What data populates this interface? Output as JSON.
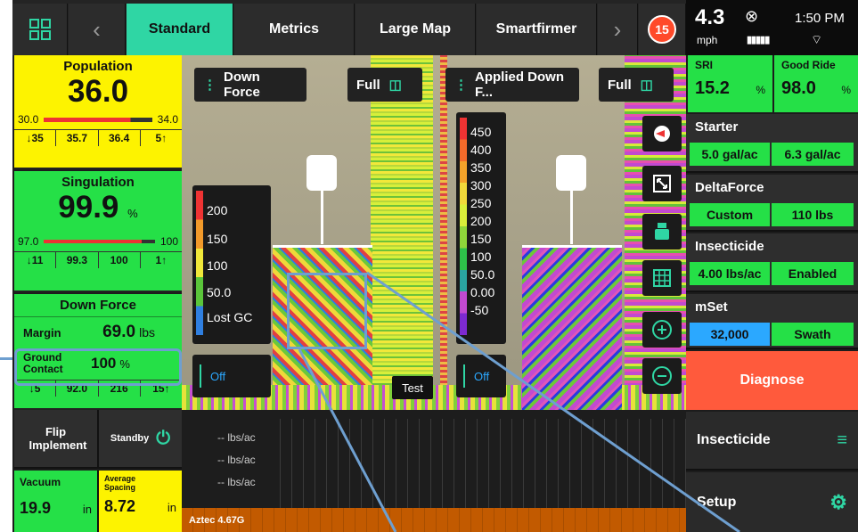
{
  "nav": {
    "tabs": [
      "Standard",
      "Metrics",
      "Large Map",
      "Smartfirmer"
    ],
    "alerts": "15"
  },
  "status": {
    "speed": "4.3",
    "speed_unit": "mph",
    "time": "1:50 PM"
  },
  "left": {
    "population": {
      "title": "Population",
      "value": "36.0",
      "min": "30.0",
      "max": "34.0",
      "row": [
        "35",
        "35.7",
        "36.4",
        "5"
      ]
    },
    "singulation": {
      "title": "Singulation",
      "value": "99.9",
      "unit": "%",
      "min": "97.0",
      "max": "100",
      "row": [
        "11",
        "99.3",
        "100",
        "1"
      ]
    },
    "downforce": {
      "title": "Down Force",
      "margin_label": "Margin",
      "margin_value": "69.0",
      "margin_unit": "lbs",
      "gc_label": "Ground Contact",
      "gc_value": "100",
      "gc_unit": "%",
      "row": [
        "5",
        "92.0",
        "216",
        "15"
      ]
    }
  },
  "map": {
    "left_header": "Down Force",
    "left_full": "Full",
    "right_header": "Applied Down F...",
    "right_full": "Full",
    "legend_left": [
      "200",
      "150",
      "100",
      "50.0",
      "Lost GC"
    ],
    "legend_right": [
      "450",
      "400",
      "350",
      "300",
      "250",
      "200",
      "150",
      "100",
      "50.0",
      "0.00",
      "-50"
    ],
    "off_left": "Off",
    "off_right": "Off",
    "test": "Test"
  },
  "right": {
    "sri_label": "SRI",
    "sri_value": "15.2",
    "sri_unit": "%",
    "goodride_label": "Good Ride",
    "goodride_value": "98.0",
    "goodride_unit": "%",
    "starter_label": "Starter",
    "starter_a": "5.0 gal/ac",
    "starter_b": "6.3 gal/ac",
    "deltaforce_label": "DeltaForce",
    "deltaforce_a": "Custom",
    "deltaforce_b": "110 lbs",
    "insecticide_label": "Insecticide",
    "insecticide_a": "4.00 lbs/ac",
    "insecticide_b": "Enabled",
    "mset_label": "mSet",
    "mset_a": "32,000",
    "mset_b": "Swath",
    "diagnose": "Diagnose",
    "insecticide_menu": "Insecticide",
    "setup": "Setup"
  },
  "bottom": {
    "flip": "Flip Implement",
    "standby": "Standby",
    "vacuum_label": "Vacuum",
    "vacuum_value": "19.9",
    "vacuum_unit": "in",
    "avg_label": "Average Spacing",
    "avg_value": "8.72",
    "avg_unit": "in",
    "graph_labels": [
      "-- lbs/ac",
      "-- lbs/ac",
      "-- lbs/ac"
    ],
    "hybrid": "Aztec 4.67G"
  },
  "colors": {
    "accent": "#2fd6a4",
    "yellow": "#fdf300",
    "green": "#25e047",
    "diagnose": "#ff5a3c",
    "blue": "#2ba8ff"
  }
}
